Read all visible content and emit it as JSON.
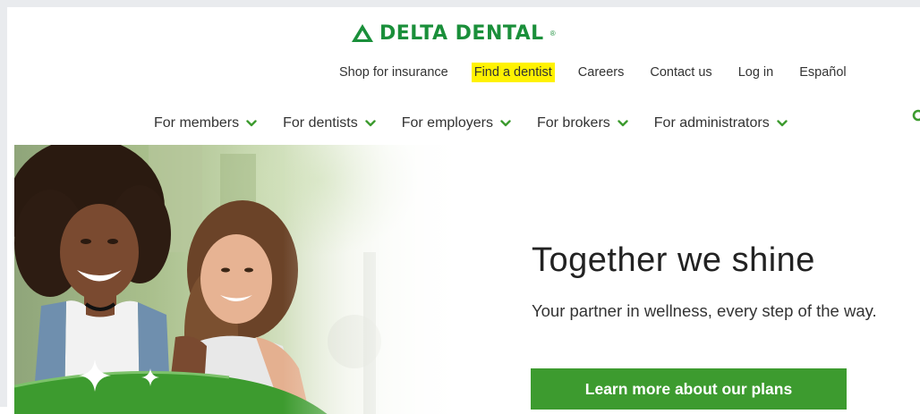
{
  "brand": {
    "name": "DELTA DENTAL",
    "registered_mark": "®",
    "color": "#1a8f3a",
    "logo_icon": "triangle-logo-icon"
  },
  "utility_nav": {
    "items": [
      {
        "label": "Shop for insurance"
      },
      {
        "label": "Find a dentist",
        "highlighted": true,
        "highlight_color": "#fff200"
      },
      {
        "label": "Careers"
      },
      {
        "label": "Contact us"
      },
      {
        "label": "Log in"
      },
      {
        "label": "Español"
      }
    ]
  },
  "main_nav": {
    "items": [
      {
        "label": "For members",
        "icon": "chevron-down-icon"
      },
      {
        "label": "For dentists",
        "icon": "chevron-down-icon"
      },
      {
        "label": "For employers",
        "icon": "chevron-down-icon"
      },
      {
        "label": "For brokers",
        "icon": "chevron-down-icon"
      },
      {
        "label": "For administrators",
        "icon": "chevron-down-icon"
      }
    ],
    "search_icon": "search-icon",
    "accent_color": "#3d9b2f"
  },
  "hero": {
    "title": "Together we shine",
    "subtitle": "Your partner in wellness, every step of the way.",
    "cta_label": "Learn more about our plans",
    "cta_color": "#3d9b2f",
    "image": "two-smiling-women-photo"
  }
}
